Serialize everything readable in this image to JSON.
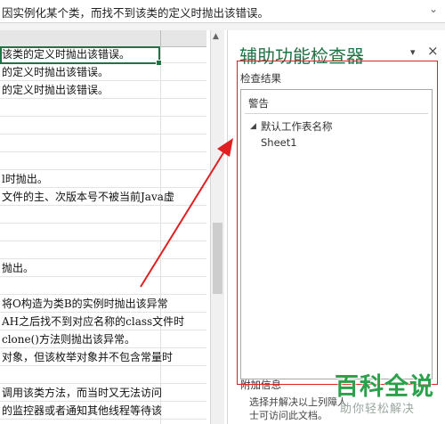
{
  "formula_bar": {
    "text": "因实例化某个类，而找不到该类的定义时抛出该错误。",
    "dropdown_icon": "chevron-down-icon"
  },
  "grid": {
    "rows": [
      "该类的定义时抛出该错误。",
      "的定义时抛出该错误。",
      "的定义时抛出该错误。",
      "",
      "",
      "",
      "",
      "l时抛出。",
      "文件的主、次版本号不被当前Java虚",
      "",
      "",
      "",
      "抛出。",
      "",
      "将O构造为类B的实例时抛出该异常",
      "AH之后找不到对应名称的class文件时",
      "clone()方法则抛出该异常。",
      "对象，但该枚举对象并不包含常量时",
      "",
      "调用该类方法，而当时又无法访问",
      "的监控器或者通知其他线程等待该"
    ]
  },
  "pane": {
    "title": "辅助功能检查器",
    "dropdown_icon": "chevron-down-icon",
    "close_icon": "close-icon",
    "results_label": "检查结果",
    "category": "警告",
    "tree_toggle_icon": "triangle-collapse-icon",
    "tree_parent": "默认工作表名称",
    "tree_child": "Sheet1",
    "extra_label": "附加信息",
    "extra_text": "选择并解决以上列障人士可访问此文档。"
  },
  "watermark": {
    "main": "百科全说",
    "sub": "助你轻松解决"
  },
  "colors": {
    "accent_green": "#217346",
    "annotation_red": "#e02020",
    "watermark_green": "#2aa14a"
  }
}
